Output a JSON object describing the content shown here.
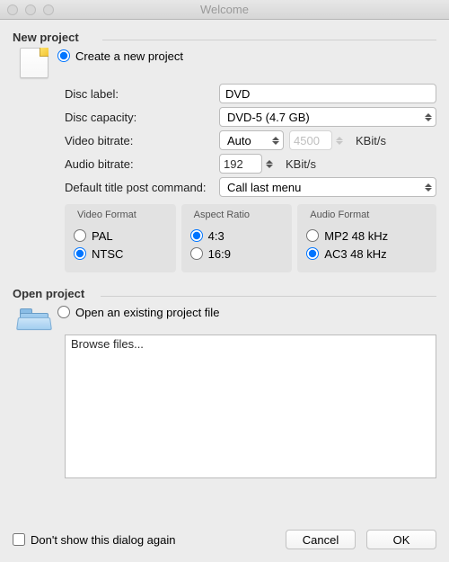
{
  "window": {
    "title": "Welcome"
  },
  "new_project": {
    "header": "New project",
    "create_label": "Create a new project",
    "create_selected": true,
    "disc_label_label": "Disc label:",
    "disc_label_value": "DVD",
    "disc_capacity_label": "Disc capacity:",
    "disc_capacity_value": "DVD-5 (4.7 GB)",
    "video_bitrate_label": "Video bitrate:",
    "video_bitrate_mode": "Auto",
    "video_bitrate_value": "4500",
    "video_bitrate_unit": "KBit/s",
    "audio_bitrate_label": "Audio bitrate:",
    "audio_bitrate_value": "192",
    "audio_bitrate_unit": "KBit/s",
    "post_command_label": "Default title post command:",
    "post_command_value": "Call last menu",
    "video_format": {
      "title": "Video Format",
      "options": [
        {
          "label": "PAL",
          "selected": false
        },
        {
          "label": "NTSC",
          "selected": true
        }
      ]
    },
    "aspect_ratio": {
      "title": "Aspect Ratio",
      "options": [
        {
          "label": "4:3",
          "selected": true
        },
        {
          "label": "16:9",
          "selected": false
        }
      ]
    },
    "audio_format": {
      "title": "Audio Format",
      "options": [
        {
          "label": "MP2 48 kHz",
          "selected": false
        },
        {
          "label": "AC3 48 kHz",
          "selected": true
        }
      ]
    }
  },
  "open_project": {
    "header": "Open project",
    "open_label": "Open an existing project file",
    "open_selected": false,
    "browse_label": "Browse files..."
  },
  "footer": {
    "dont_show_label": "Don't show this dialog again",
    "dont_show_checked": false,
    "cancel": "Cancel",
    "ok": "OK"
  }
}
